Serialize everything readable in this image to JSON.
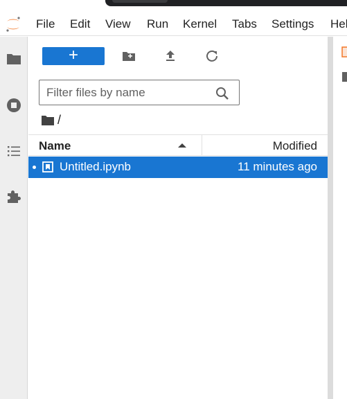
{
  "menubar": {
    "items": [
      "File",
      "Edit",
      "View",
      "Run",
      "Kernel",
      "Tabs",
      "Settings",
      "Hel"
    ]
  },
  "toolbar": {
    "new_label": "+"
  },
  "filter": {
    "placeholder": "Filter files by name"
  },
  "breadcrumb": {
    "path": "/"
  },
  "file_list": {
    "columns": {
      "name": "Name",
      "modified": "Modified"
    },
    "rows": [
      {
        "name": "Untitled.ipynb",
        "modified": "11 minutes ago"
      }
    ]
  },
  "colors": {
    "accent": "#1976d2",
    "jupyter_orange": "#f37626"
  }
}
